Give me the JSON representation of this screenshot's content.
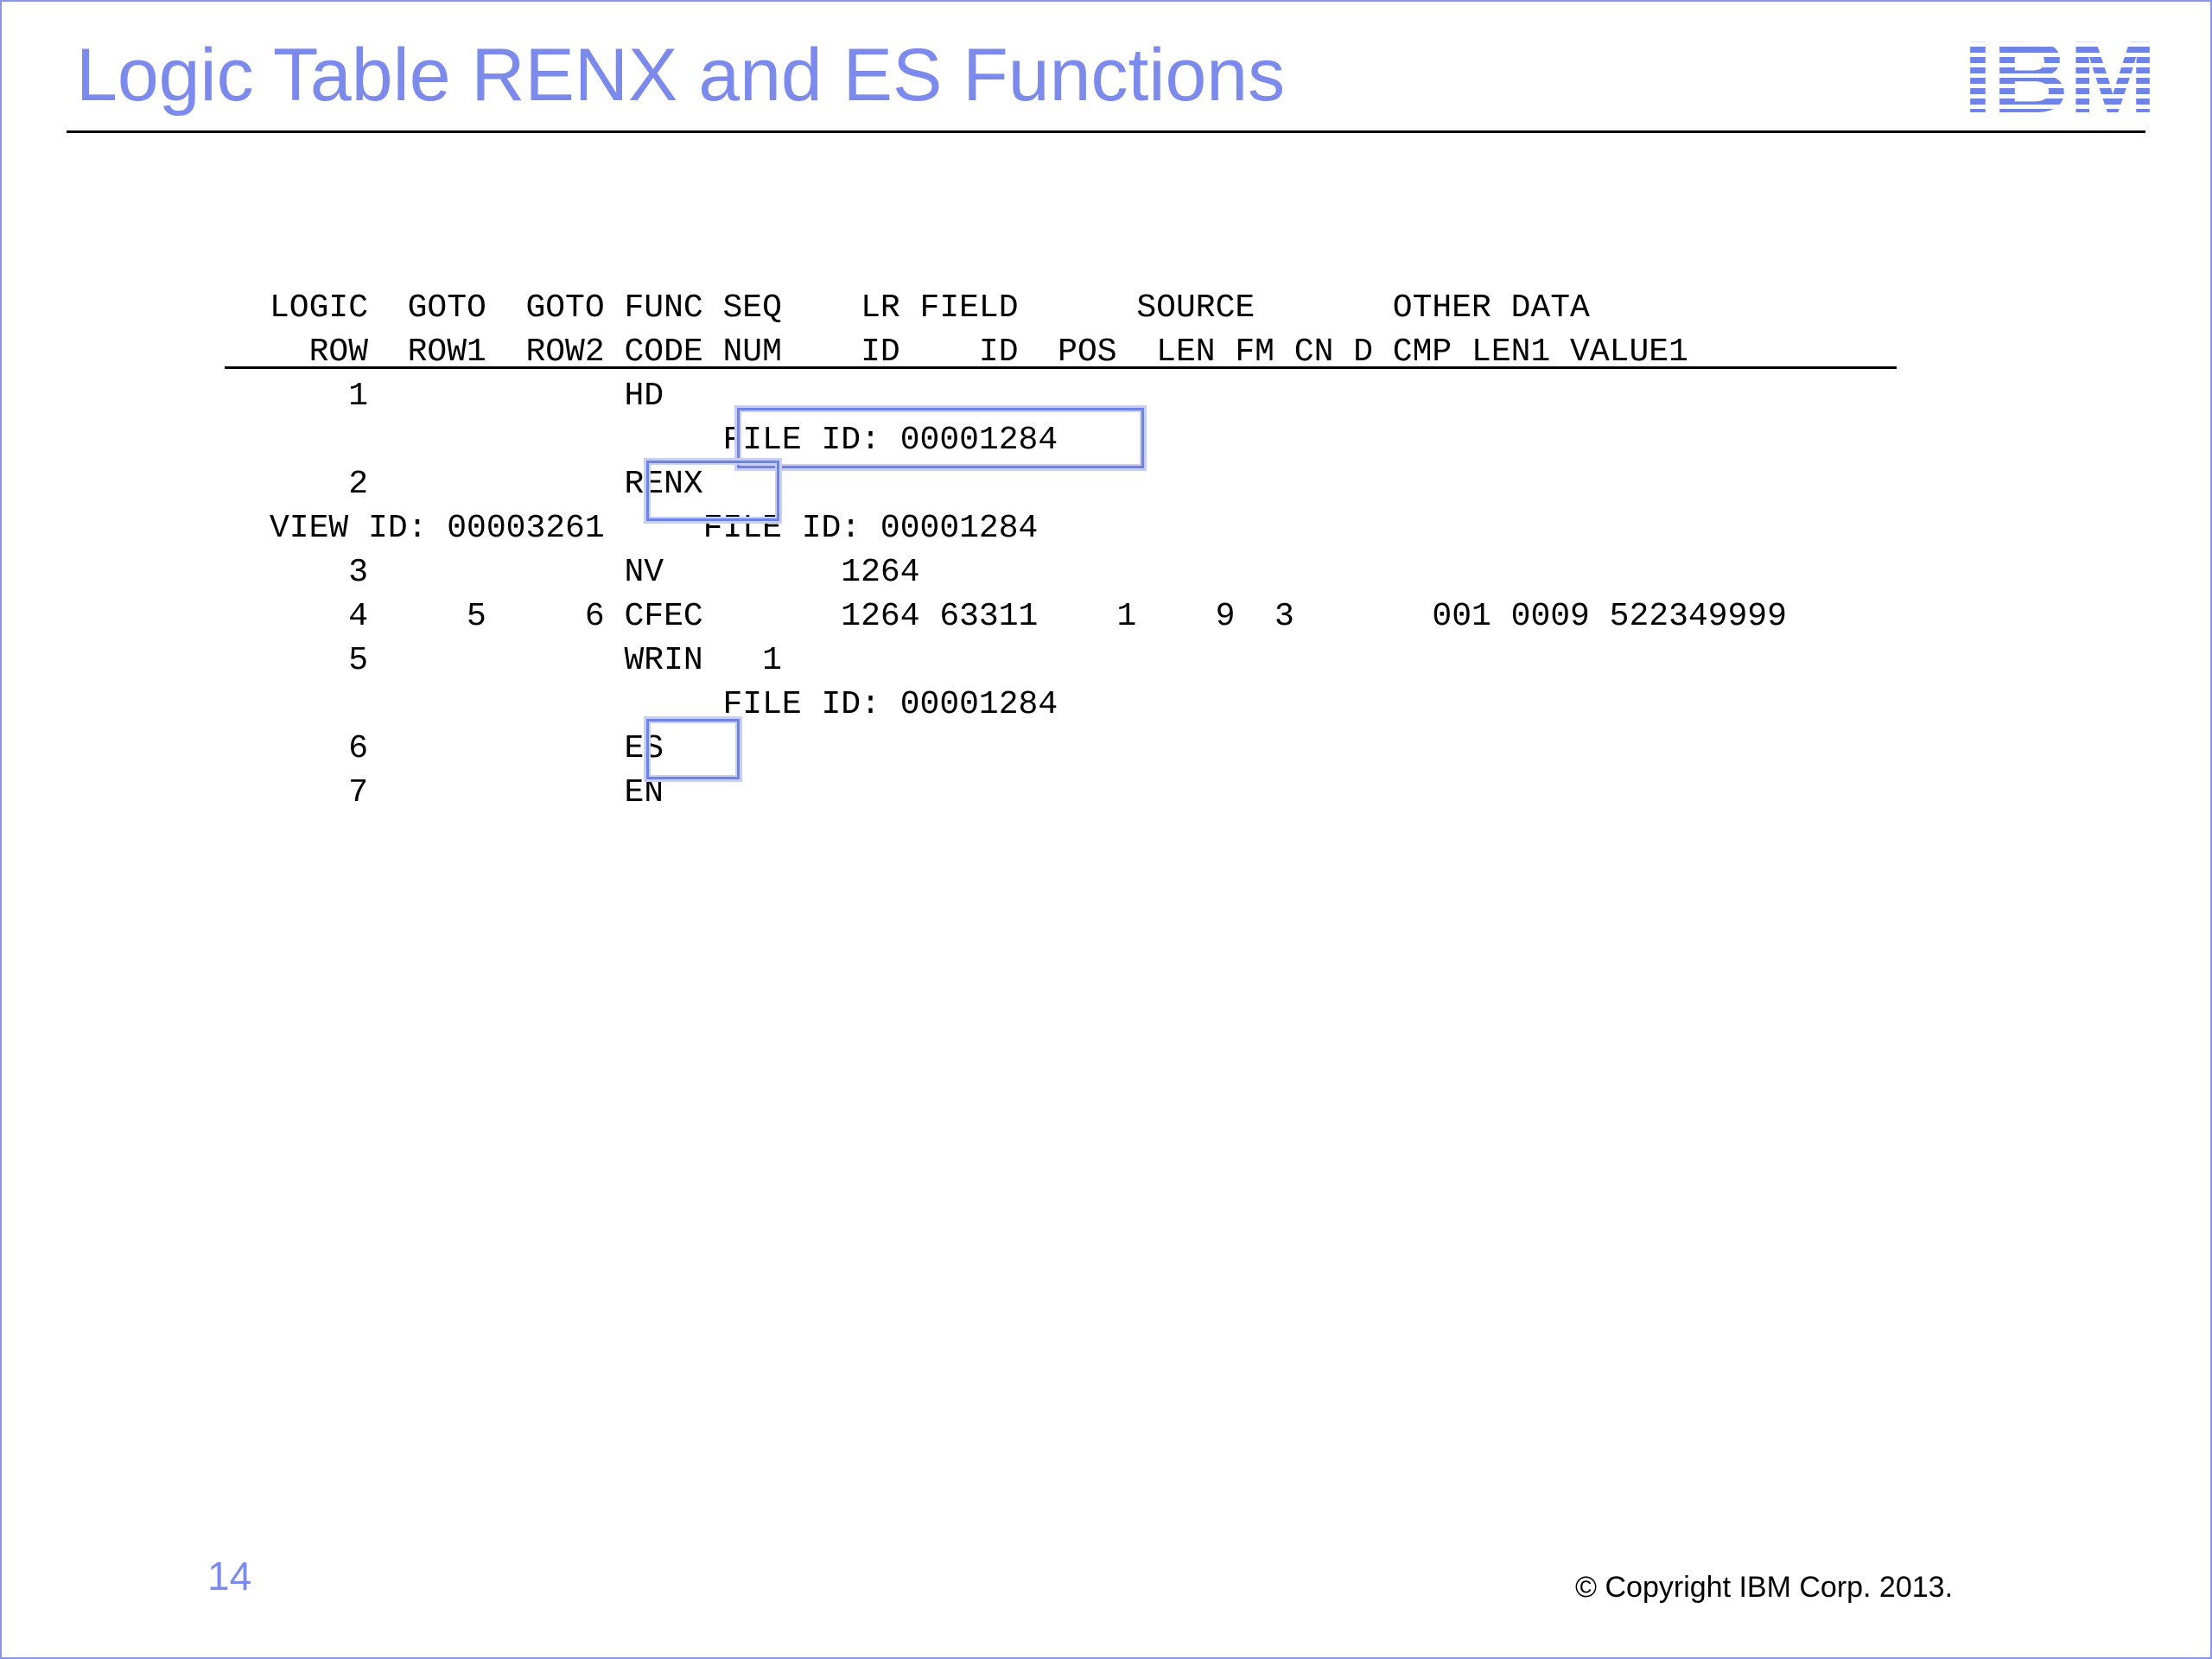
{
  "slide": {
    "title": "Logic Table RENX and ES Functions",
    "page_number": "14",
    "copyright": "© Copyright IBM Corp. 2013.",
    "logo_text": "IBM",
    "accent_color": "#7b8aeb"
  },
  "table": {
    "header_lines": [
      "LOGIC  GOTO  GOTO FUNC SEQ    LR FIELD      SOURCE       OTHER DATA",
      "  ROW  ROW1  ROW2 CODE NUM    ID    ID  POS  LEN FM CN D CMP LEN1 VALUE1"
    ],
    "lines": [
      "    1             HD",
      "                       FILE ID: 00001284",
      "    2             RENX",
      "VIEW ID: 00003261     FILE ID: 00001284",
      "    3             NV         1264",
      "    4     5     6 CFEC       1264 63311    1    9  3       001 0009 522349999",
      "    5             WRIN   1",
      "                       FILE ID: 00001284",
      "    6             ES",
      "    7             EN"
    ],
    "highlighted": [
      "FILE ID: 00001284",
      "RENX",
      "ES"
    ]
  }
}
